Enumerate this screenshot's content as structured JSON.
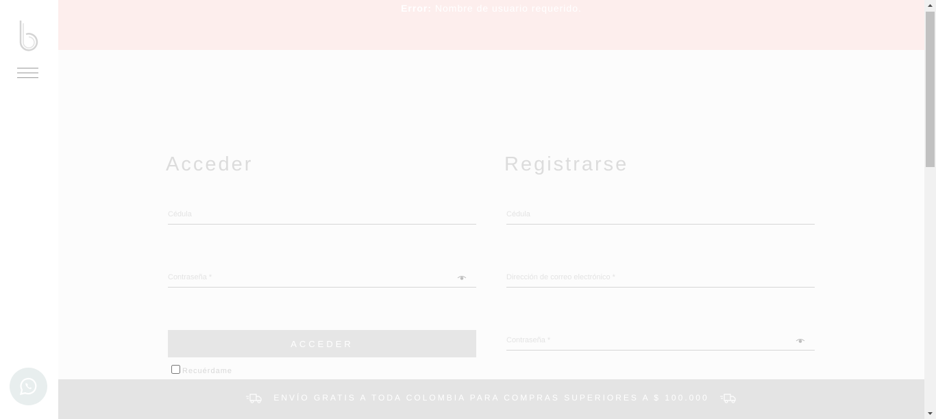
{
  "error": {
    "label": "Error:",
    "message": "Nombre de usuario requerido."
  },
  "login": {
    "title": "Acceder",
    "cedula_placeholder": "Cédula",
    "password_placeholder": "Contraseña *",
    "button_label": "ACCEDER",
    "remember_label": "Recuérdame"
  },
  "register": {
    "title": "Registrarse",
    "cedula_placeholder": "Cédula",
    "email_placeholder": "Dirección de correo electrónico *",
    "password_placeholder": "Contraseña *"
  },
  "shipping": {
    "text": "ENVÍO GRATIS A TODA COLOMBIA PARA COMPRAS SUPERIORES A $ 100.000"
  },
  "icons": {
    "logo": "b-logo-icon",
    "menu": "hamburger-menu-icon",
    "whatsapp": "whatsapp-icon",
    "eye": "eye-icon",
    "truck": "delivery-truck-icon"
  },
  "colors": {
    "error_bg": "#fdeeed",
    "shipping_bg": "#e4e4e4",
    "button_bg": "#e6e6e6",
    "page_bg": "#fcfcfc"
  }
}
